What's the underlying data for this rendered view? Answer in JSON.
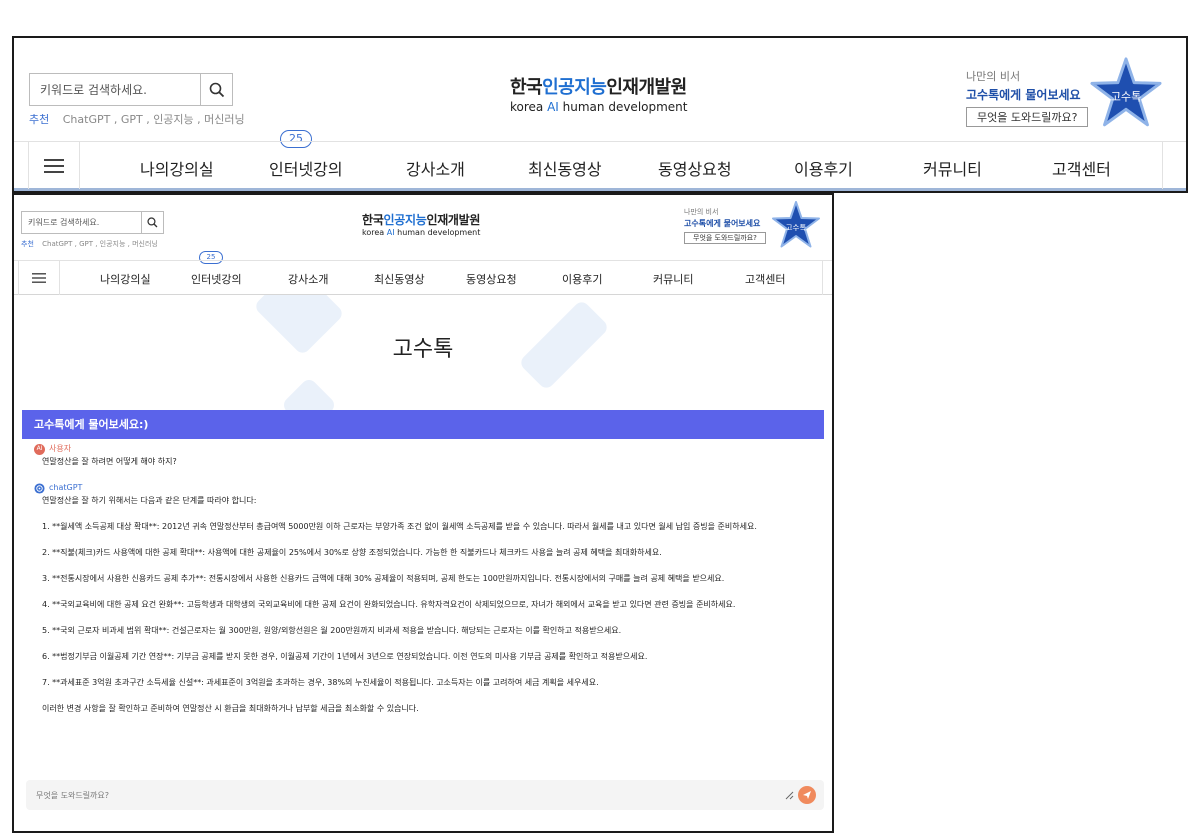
{
  "header": {
    "search_placeholder": "키워드로 검색하세요.",
    "recommend_label": "추천",
    "recommend_terms": "ChatGPT , GPT , 인공지능 , 머신러닝",
    "logo_ko_prefix": "한국",
    "logo_ko_highlight": "인공지능",
    "logo_ko_suffix": "인재개발원",
    "logo_en_prefix": "korea ",
    "logo_en_highlight": "AI",
    "logo_en_suffix": " human development",
    "assistant_sub": "나만의 비서",
    "assistant_main": "고수톡에게 물어보세요",
    "assistant_button": "무엇을 도와드릴까요?",
    "assistant_badge": "고수톡"
  },
  "nav": {
    "badge_count": "25",
    "items": [
      "나의강의실",
      "인터넷강의",
      "강사소개",
      "최신동영상",
      "동영상요청",
      "이용후기",
      "커뮤니티",
      "고객센터"
    ]
  },
  "page": {
    "title": "고수톡",
    "chat_header": "고수톡에게 물어보세요:)",
    "user_label": "사용자",
    "user_avatar": "AI",
    "user_message": "연말정산을 잘 하려면 어떻게 해야 하지?",
    "bot_label": "chatGPT",
    "bot_intro": "연말정산을 잘 하기 위해서는 다음과 같은 단계를 따라야 합니다:",
    "bot_points": [
      "1. **월세액 소득공제 대상 확대**: 2012년 귀속 연말정산부터 총급여액 5000만원 이하 근로자는 부양가족 조건 없이 월세액 소득공제를 받을 수 있습니다. 따라서 월세를 내고 있다면 월세 납입 증빙을 준비하세요.",
      "2. **직불(체크)카드 사용액에 대한 공제 확대**: 사용액에 대한 공제율이 25%에서 30%로 상향 조정되었습니다. 가능한 한 직불카드나 체크카드 사용을 늘려 공제 혜택을 최대화하세요.",
      "3. **전통시장에서 사용한 신용카드 공제 추가**: 전통시장에서 사용한 신용카드 금액에 대해 30% 공제율이 적용되며, 공제 한도는 100만원까지입니다. 전통시장에서의 구매를 늘려 공제 혜택을 받으세요.",
      "4. **국외교육비에 대한 공제 요건 완화**: 고등학생과 대학생의 국외교육비에 대한 공제 요건이 완화되었습니다. 유학자격요건이 삭제되었으므로, 자녀가 해외에서 교육을 받고 있다면 관련 증빙을 준비하세요.",
      "5. **국외 근로자 비과세 범위 확대**: 건설근로자는 월 300만원, 원양/외항선원은 월 200만원까지 비과세 적용을 받습니다. 해당되는 근로자는 이를 확인하고 적용받으세요.",
      "6. **법정기부금 이월공제 기간 연장**: 기부금 공제를 받지 못한 경우, 이월공제 기간이 1년에서 3년으로 연장되었습니다. 이전 연도의 미사용 기부금 공제를 확인하고 적용받으세요.",
      "7. **과세표준 3억원 초과구간 소득세율 신설**: 과세표준이 3억원을 초과하는 경우, 38%의 누진세율이 적용됩니다. 고소득자는 이를 고려하여 세금 계획을 세우세요."
    ],
    "bot_outro": "이러한 변경 사항을 잘 확인하고 준비하여 연말정산 시 환급을 최대화하거나 납부할 세금을 최소화할 수 있습니다.",
    "input_placeholder": "무엇을 도와드릴까요?"
  },
  "colors": {
    "accent": "#5b63ea",
    "brand_blue": "#1f6fd1",
    "send": "#f08a5d"
  }
}
